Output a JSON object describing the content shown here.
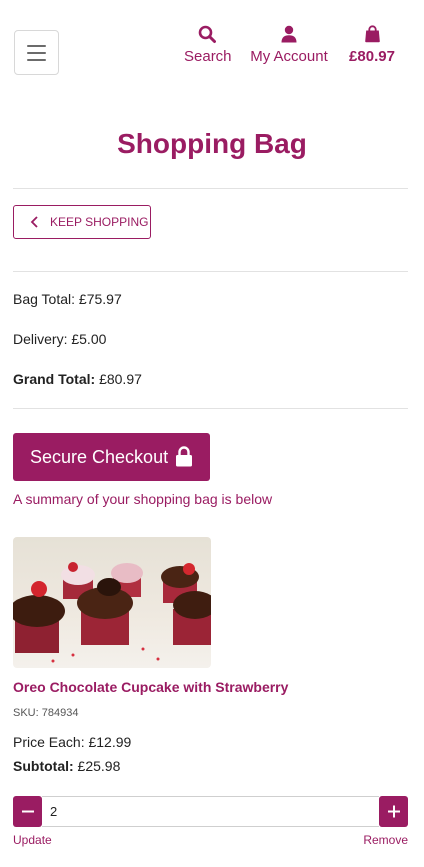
{
  "header": {
    "search_label": "Search",
    "account_label": "My Account",
    "bag_total": "£80.97",
    "icons": [
      "hamburger-menu-icon",
      "search-icon",
      "user-icon",
      "shopping-bag-icon"
    ]
  },
  "page": {
    "title": "Shopping Bag",
    "keep_shopping_label": "KEEP SHOPPING"
  },
  "summary": {
    "bag_total_label": "Bag Total:",
    "bag_total_value": "£75.97",
    "delivery_label": "Delivery:",
    "delivery_value": "£5.00",
    "grand_total_label": "Grand Total:",
    "grand_total_value": "£80.97"
  },
  "checkout": {
    "button_label": "Secure Checkout",
    "note": "A summary of your shopping bag is below"
  },
  "item": {
    "name": "Oreo Chocolate Cupcake with Strawberry",
    "sku": "SKU: 784934",
    "price_each_label": "Price Each:",
    "price_each_value": "£12.99",
    "subtotal_label": "Subtotal:",
    "subtotal_value": "£25.98",
    "quantity": "2",
    "update_label": "Update",
    "remove_label": "Remove"
  },
  "colors": {
    "brand": "#9a1c62",
    "divider": "#e2e2e2"
  }
}
